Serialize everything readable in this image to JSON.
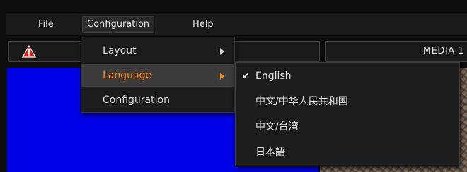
{
  "menubar": {
    "file_label": "File",
    "configuration_label": "Configuration",
    "help_label": "Help"
  },
  "toolbar": {
    "media_label": "MEDIA 1",
    "warning_icon": "warning-triangle-icon",
    "warning_color": "#e02020"
  },
  "configuration_menu": {
    "items": [
      {
        "label": "Layout",
        "has_submenu": true
      },
      {
        "label": "Language",
        "has_submenu": true,
        "highlighted": true
      },
      {
        "label": "Configuration",
        "has_submenu": false
      }
    ],
    "highlight_color": "#ff8a1e"
  },
  "language_menu": {
    "items": [
      {
        "label": "English",
        "checked": true,
        "check_glyph": "✔"
      },
      {
        "label": "中文/中华人民共和国",
        "checked": false
      },
      {
        "label": "中文/台湾",
        "checked": false
      },
      {
        "label": "日本語",
        "checked": false
      }
    ]
  },
  "colors": {
    "video_panel": "#0000e6",
    "menu_background": "#1c1c1c"
  }
}
